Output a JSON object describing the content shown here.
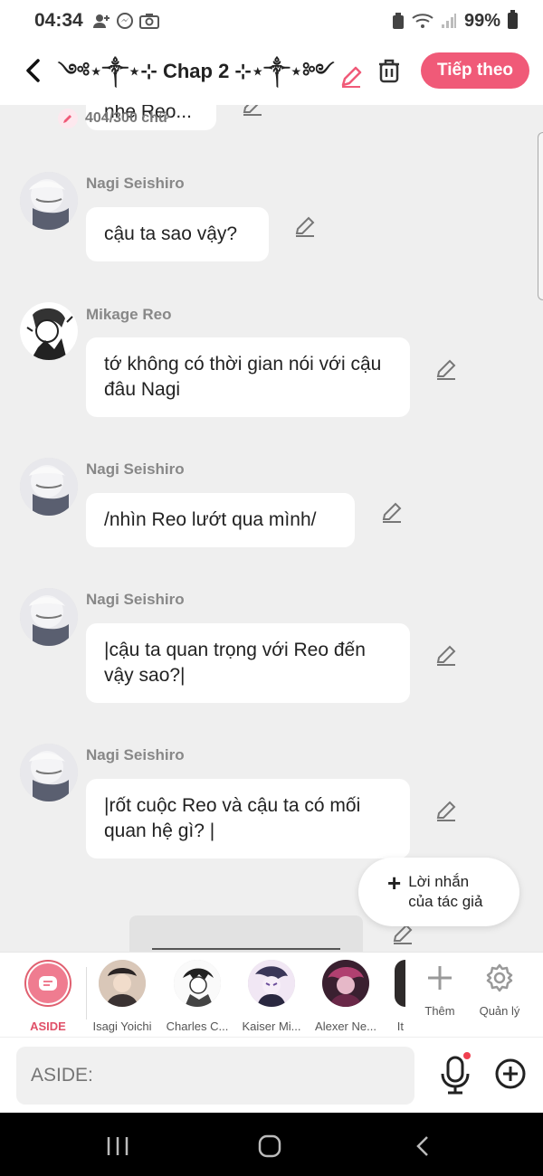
{
  "status": {
    "time": "04:34",
    "battery": "99%"
  },
  "header": {
    "title": "⊱∵⊰✝⊱∵⊰ Chap 2 ⊱∵⊰✝⊱∵⊰",
    "title_display": "༺⋆༒⋆⊹ Chap 2 ⊹⋆༒⋆༻",
    "word_count": "404/300 chữ",
    "next_label": "Tiếp theo"
  },
  "messages": [
    {
      "text": "nhe Reo..."
    },
    {
      "name": "Nagi Seishiro",
      "text": "cậu ta sao vậy?"
    },
    {
      "name": "Mikage Reo",
      "text": "tớ không có thời gian nói với cậu đâu Nagi"
    },
    {
      "name": "Nagi Seishiro",
      "text": "/nhìn Reo lướt qua mình/"
    },
    {
      "name": "Nagi Seishiro",
      "text": "|cậu ta quan trọng với Reo đến vậy sao?|"
    },
    {
      "name": "Nagi Seishiro",
      "text": "|rốt cuộc Reo và cậu ta có mối quan hệ gì? |"
    }
  ],
  "author_note": {
    "line1": "Lời nhắn",
    "line2": "của tác giả"
  },
  "characters": {
    "aside": "ASIDE",
    "items": [
      "Isagi Yoichi",
      "Charles C...",
      "Kaiser Mi...",
      "Alexer Ne...",
      "It"
    ],
    "more": "Thêm",
    "manage": "Quản lý"
  },
  "input": {
    "placeholder": "ASIDE:"
  },
  "colors": {
    "accent": "#f05a78",
    "background": "#efefef"
  }
}
